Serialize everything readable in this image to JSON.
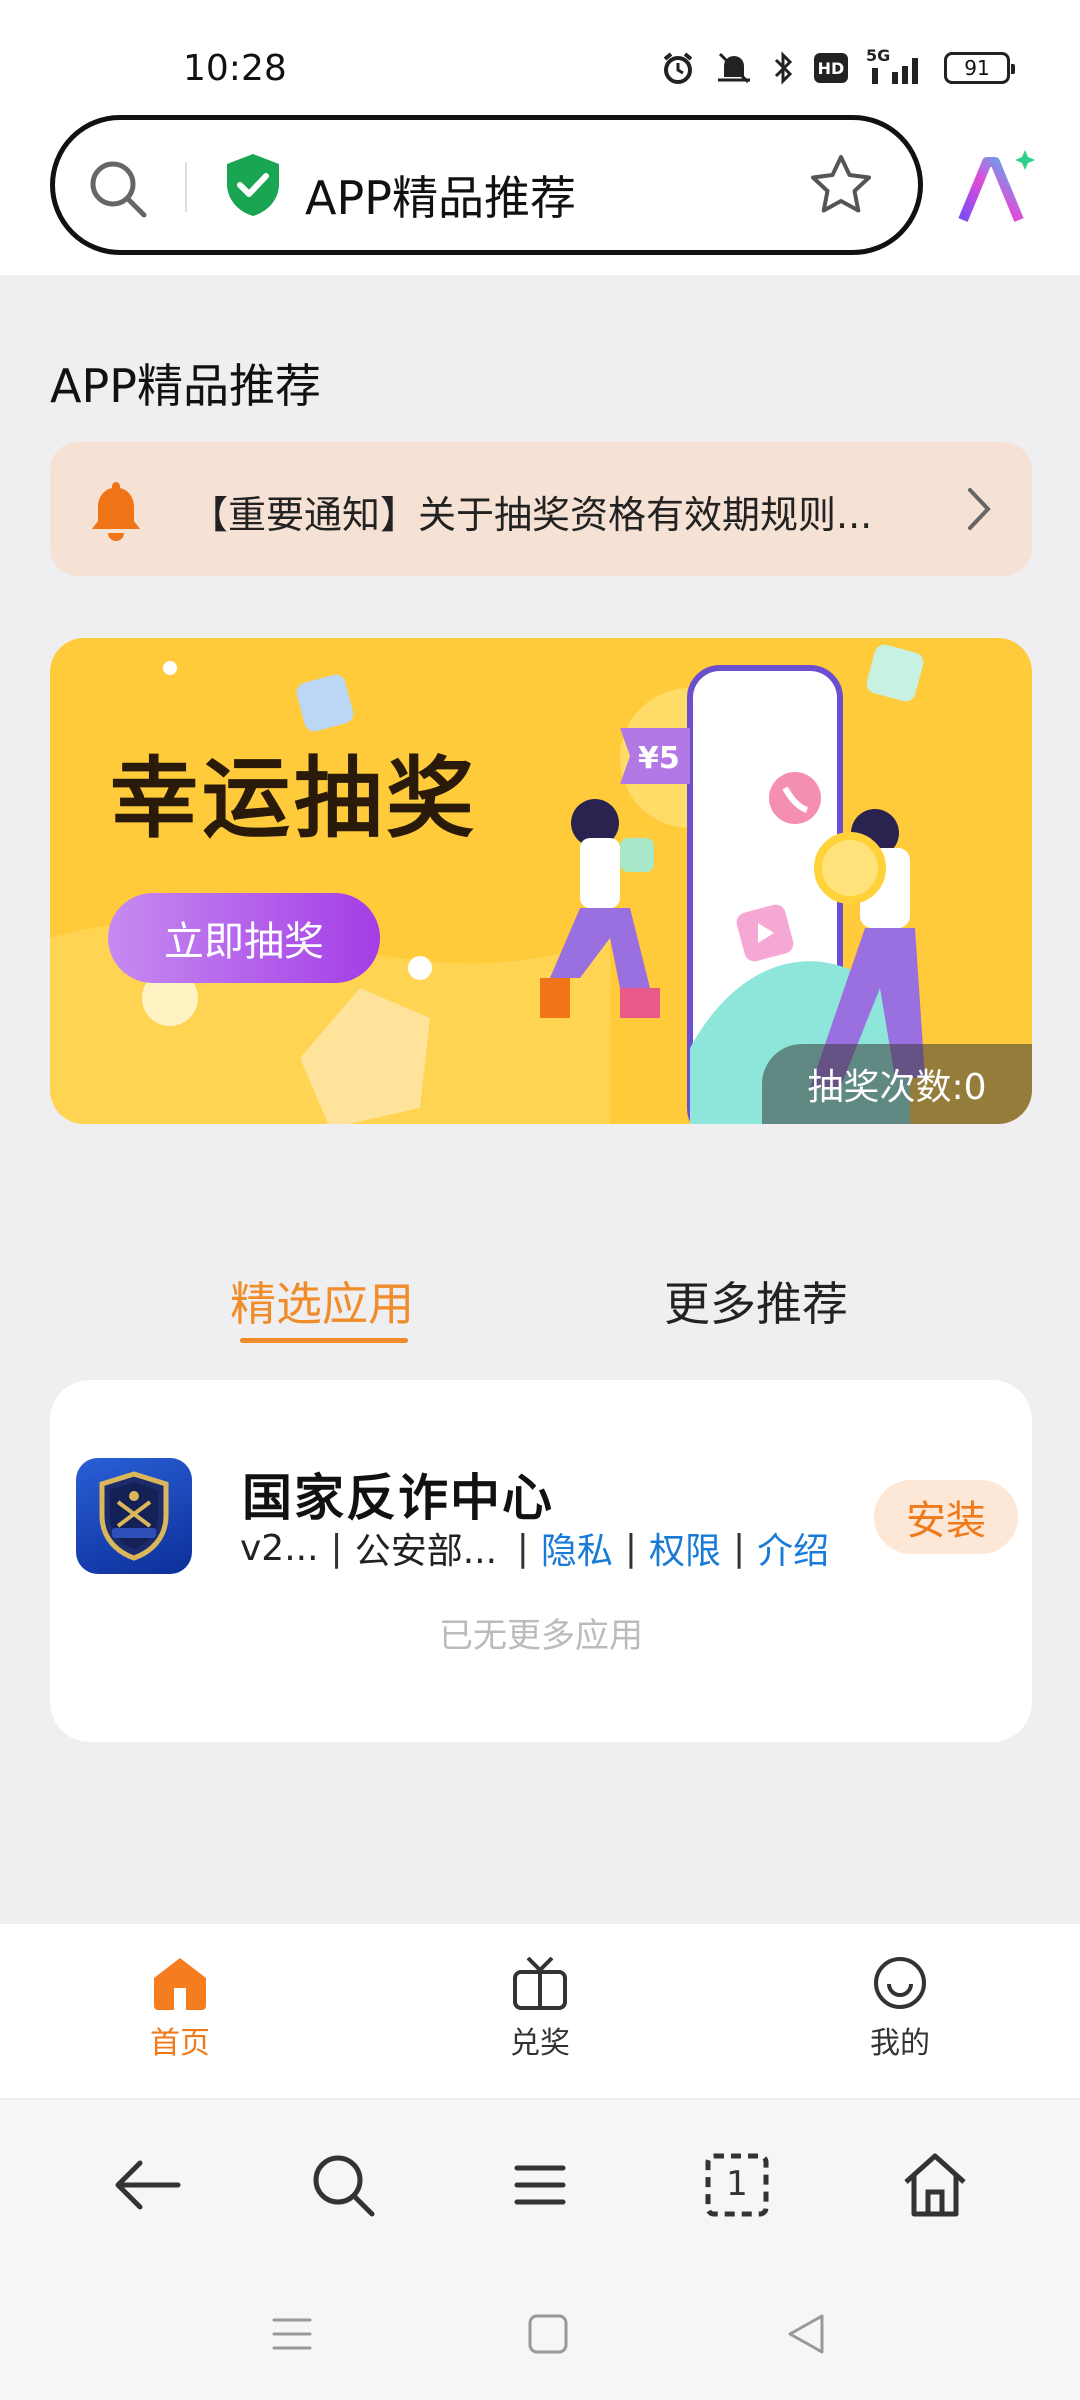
{
  "status": {
    "time": "10:28",
    "network": "5G",
    "hd": "HD",
    "battery": "91"
  },
  "address_bar": {
    "title": "APP精品推荐"
  },
  "page": {
    "title": "APP精品推荐"
  },
  "notice": {
    "text": "【重要通知】关于抽奖资格有效期规则..."
  },
  "banner": {
    "title": "幸运抽奖",
    "button": "立即抽奖",
    "coupon": "¥5",
    "count_label": "抽奖次数:0"
  },
  "tabs": [
    {
      "label": "精选应用",
      "selected": true
    },
    {
      "label": "更多推荐",
      "selected": false
    }
  ],
  "apps": [
    {
      "name": "国家反诈中心",
      "version": "v2...",
      "developer": "公安部...",
      "privacy": "隐私",
      "permissions": "权限",
      "intro": "介绍",
      "install": "安装"
    }
  ],
  "list_end": "已无更多应用",
  "bottom_nav": [
    {
      "label": "首页",
      "icon": "home-icon",
      "active": true
    },
    {
      "label": "兑奖",
      "icon": "gift-tv-icon",
      "active": false
    },
    {
      "label": "我的",
      "icon": "smile-icon",
      "active": false
    }
  ],
  "browser_toolbar": {
    "tabs_count": "1"
  },
  "colors": {
    "accent": "#f08c2a",
    "link": "#1a7bd6",
    "banner_bg": "#ffcb3a",
    "button_purple": "#a43de6"
  }
}
